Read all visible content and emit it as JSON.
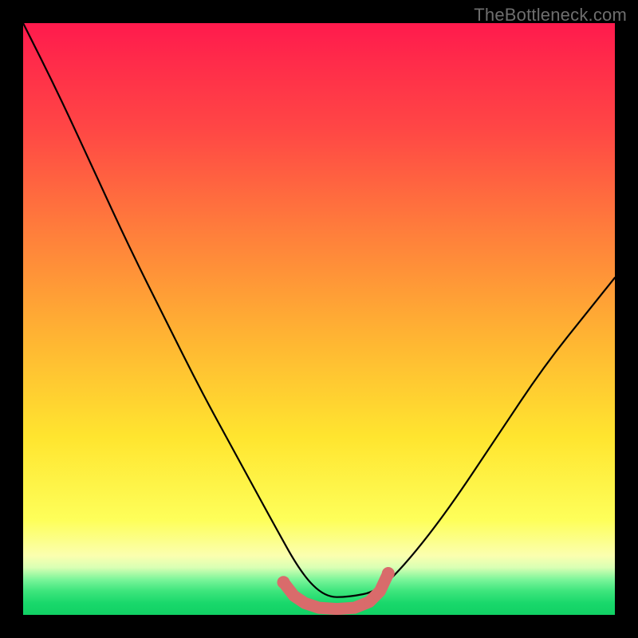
{
  "watermark": "TheBottleneck.com",
  "chart_data": {
    "type": "line",
    "title": "",
    "xlabel": "",
    "ylabel": "",
    "xlim": [
      0,
      1
    ],
    "ylim": [
      0,
      1
    ],
    "series": [
      {
        "name": "bottleneck-curve",
        "x": [
          0.0,
          0.06,
          0.12,
          0.18,
          0.24,
          0.3,
          0.36,
          0.42,
          0.47,
          0.51,
          0.55,
          0.6,
          0.65,
          0.72,
          0.8,
          0.88,
          0.96,
          1.0
        ],
        "y": [
          1.0,
          0.88,
          0.75,
          0.62,
          0.5,
          0.38,
          0.27,
          0.16,
          0.07,
          0.03,
          0.03,
          0.04,
          0.09,
          0.18,
          0.3,
          0.42,
          0.52,
          0.57
        ]
      },
      {
        "name": "optimal-range-marker",
        "x": [
          0.44,
          0.458,
          0.476,
          0.5,
          0.53,
          0.56,
          0.585,
          0.603,
          0.617
        ],
        "y": [
          0.055,
          0.032,
          0.02,
          0.012,
          0.01,
          0.012,
          0.022,
          0.04,
          0.07
        ]
      }
    ],
    "colors": {
      "curve": "#000000",
      "marker": "#d96b6b",
      "gradient_top": "#ff1a4d",
      "gradient_mid": "#ffe52f",
      "gradient_bottom": "#11d164"
    }
  }
}
